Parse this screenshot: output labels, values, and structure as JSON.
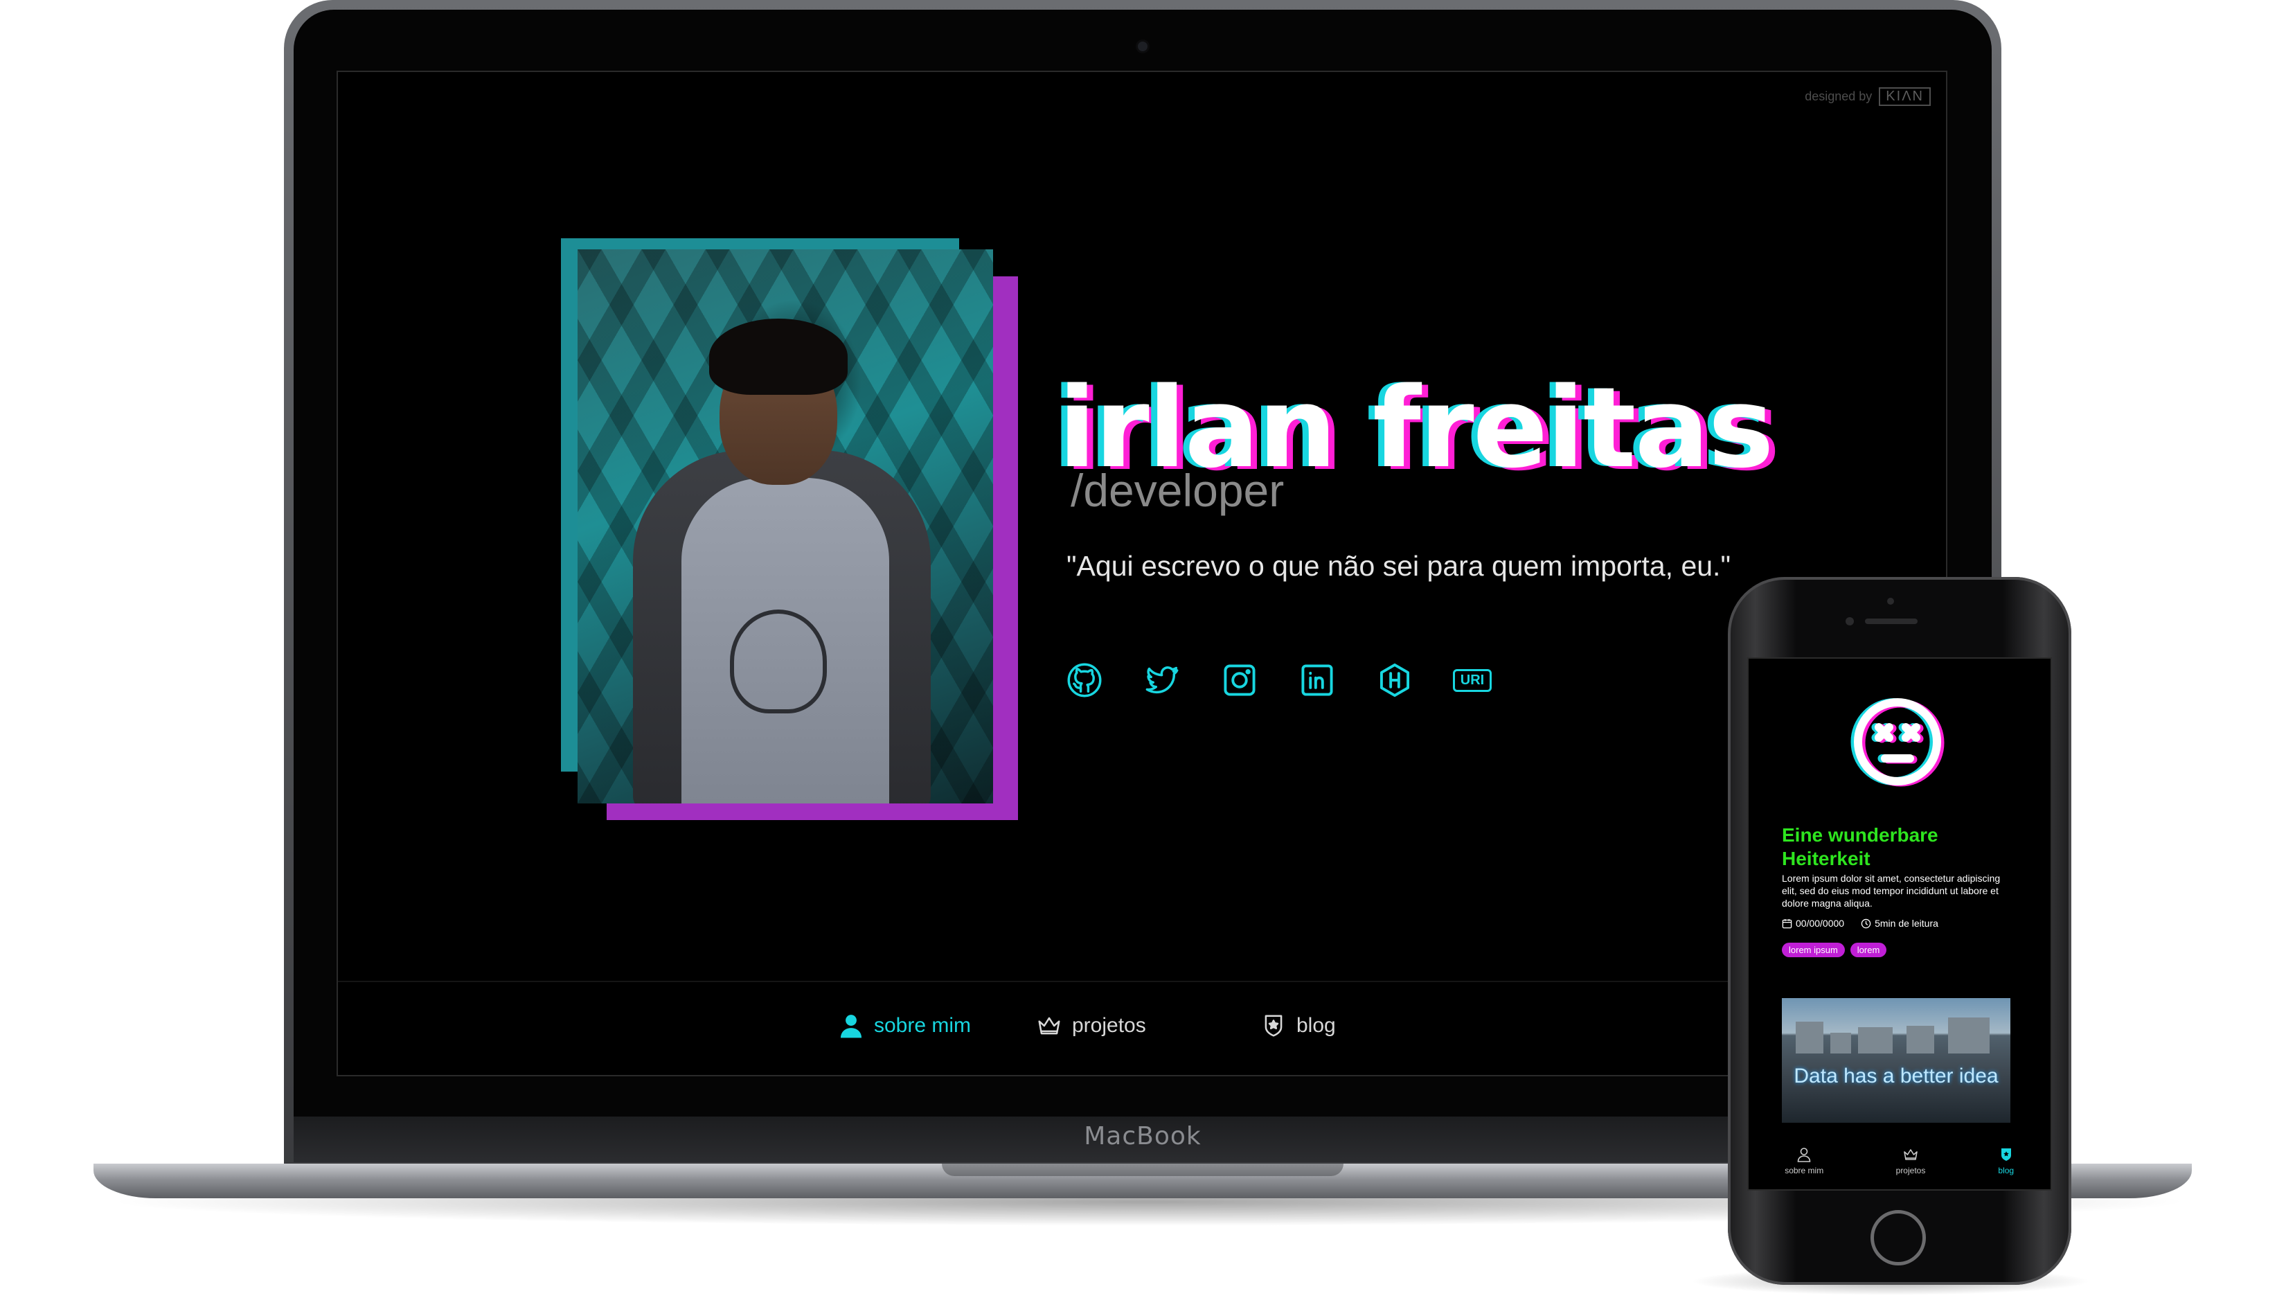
{
  "laptop": {
    "brand_label": "MacBook",
    "credit": {
      "prefix": "designed by",
      "logo_text": "KIΛN"
    },
    "profile": {
      "name": "irlan freitas",
      "role": "/developer",
      "quote": "\"Aqui escrevo o que não sei para quem importa, eu.\""
    },
    "socials": [
      {
        "icon": "github-icon"
      },
      {
        "icon": "twitter-icon"
      },
      {
        "icon": "instagram-icon"
      },
      {
        "icon": "linkedin-icon"
      },
      {
        "icon": "hackerrank-icon"
      },
      {
        "icon": "uri-icon",
        "label": "URI"
      }
    ],
    "nav": [
      {
        "label": "sobre mim",
        "icon": "user-icon",
        "active": true
      },
      {
        "label": "projetos",
        "icon": "crown-icon",
        "active": false
      },
      {
        "label": "blog",
        "icon": "shield-star-icon",
        "active": false
      }
    ]
  },
  "phone": {
    "post": {
      "title": "Eine wunderbare Heiterkeit",
      "excerpt": "Lorem ipsum dolor sit amet, consectetur adipiscing elit, sed do eius mod tempor incididunt ut labore et dolore magna aliqua.",
      "date": "00/00/0000",
      "read_time": "5min de leitura",
      "tags": [
        "lorem ipsum",
        "lorem"
      ],
      "image_text": "Data has a better idea"
    },
    "nav": [
      {
        "label": "sobre mim",
        "icon": "user-icon",
        "active": false
      },
      {
        "label": "projetos",
        "icon": "crown-icon",
        "active": false
      },
      {
        "label": "blog",
        "icon": "shield-star-icon",
        "active": true
      }
    ]
  },
  "colors": {
    "accent_cyan": "#18d6e0",
    "accent_magenta": "#ff1fd5",
    "post_title_green": "#2ee51f",
    "tag_purple": "#c01fd6",
    "photo_frame_teal": "#1d8e96",
    "photo_frame_purple": "#a12fc0"
  }
}
